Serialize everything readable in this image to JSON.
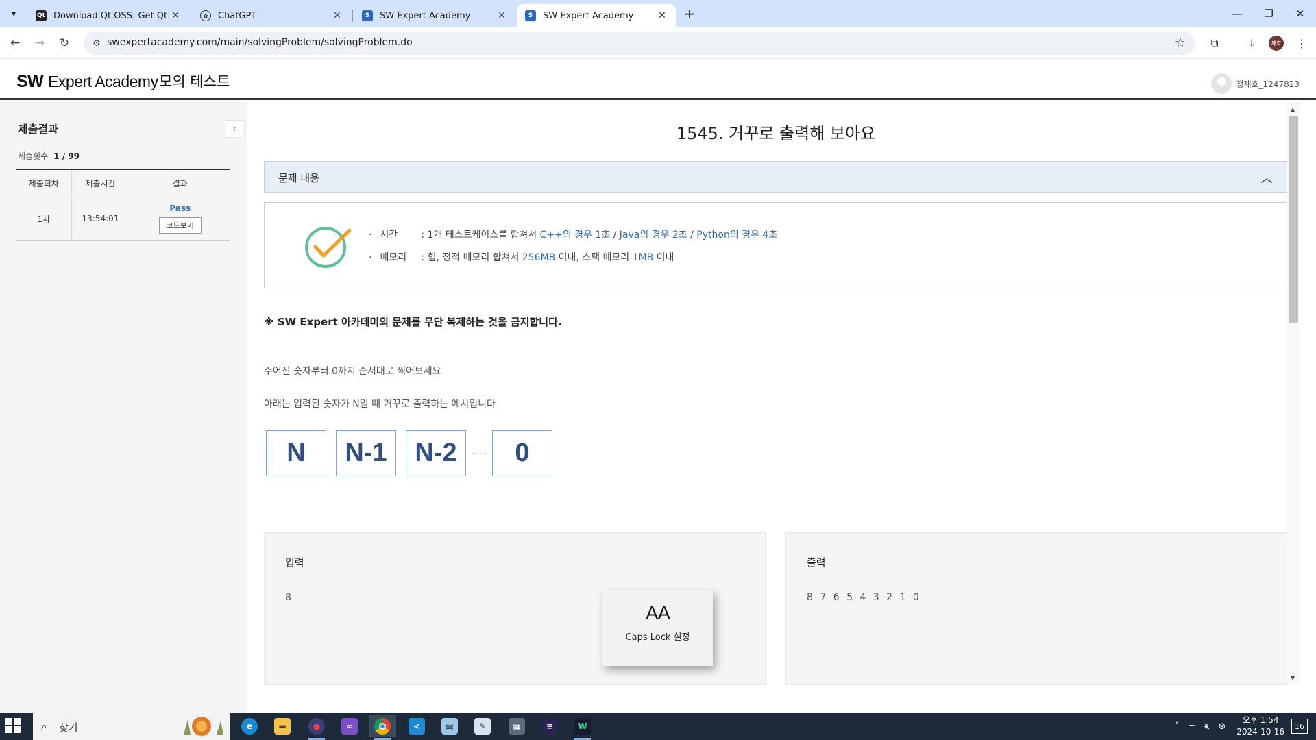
{
  "browser": {
    "tabs": [
      {
        "title": "Download Qt OSS: Get Qt Onl",
        "favicon": "qt-favicon",
        "active": false
      },
      {
        "title": "ChatGPT",
        "favicon": "chatgpt-favicon",
        "active": false
      },
      {
        "title": "SW Expert Academy",
        "favicon": "swea-favicon",
        "active": false
      },
      {
        "title": "SW Expert Academy",
        "favicon": "swea-favicon",
        "active": true
      }
    ],
    "url": "swexpertacademy.com/main/solvingProblem/solvingProblem.do",
    "profile_initials": "재호"
  },
  "header": {
    "logo_bold": "SW",
    "logo_rest": "Expert Academy",
    "title": "모의 테스트",
    "user_name": "정재호_1247823"
  },
  "left_panel": {
    "title": "제출결과",
    "count_label": "제출횟수",
    "count_value": "1 / 99",
    "columns": [
      "제출회차",
      "제출시간",
      "결과"
    ],
    "rows": [
      {
        "round": "1차",
        "time": "13:54:01",
        "result": "Pass",
        "code_button": "코드보기"
      }
    ]
  },
  "problem": {
    "title": "1545. 거꾸로 출력해 보아요",
    "accordion_label": "문제 내용",
    "time_label": "시간",
    "time_prefix": ": 1개 테스트케이스를 합쳐서",
    "time_cpp": "C++의 경우 1초",
    "time_java": "Java의 경우 2초",
    "time_python": "Python의 경우 4초",
    "slash": "/",
    "memory_label": "메모리",
    "memory_prefix": ": 힙, 정적 메모리 합쳐서",
    "memory_heap": "256MB",
    "memory_mid": "이내, 스택 메모리",
    "memory_stack": "1MB",
    "memory_suffix": "이내",
    "notice": "※ SW Expert 아카데미의 문제를 무단 복제하는 것을 금지합니다.",
    "description_1": "주어진 숫자부터 0까지 순서대로 찍어보세요",
    "description_2": "아래는 입력된 숫자가 N일 때 거꾸로 출력하는 예시입니다",
    "sequence": [
      "N",
      "N-1",
      "N-2",
      "0"
    ],
    "sequence_dots": "····",
    "input_label": "입력",
    "input_value": "8",
    "output_label": "출력",
    "output_value": "8 7 6 5 4 3 2 1 0"
  },
  "caps_overlay": {
    "big_text": "AA",
    "label": "Caps Lock 설정"
  },
  "taskbar": {
    "search_text": "찾기",
    "apps": [
      "edge",
      "file-explorer",
      "app-red",
      "visual-studio",
      "chrome",
      "vscode",
      "notepad",
      "paint",
      "calculator",
      "eclipse",
      "webstorm"
    ],
    "time": "오후 1:54",
    "date": "2024-10-16",
    "notification_count": "16"
  },
  "colors": {
    "accent_blue": "#2e6db4",
    "check_green": "#5cbf9a",
    "check_orange": "#f0a020",
    "tabstrip": "#d3e3fd"
  }
}
